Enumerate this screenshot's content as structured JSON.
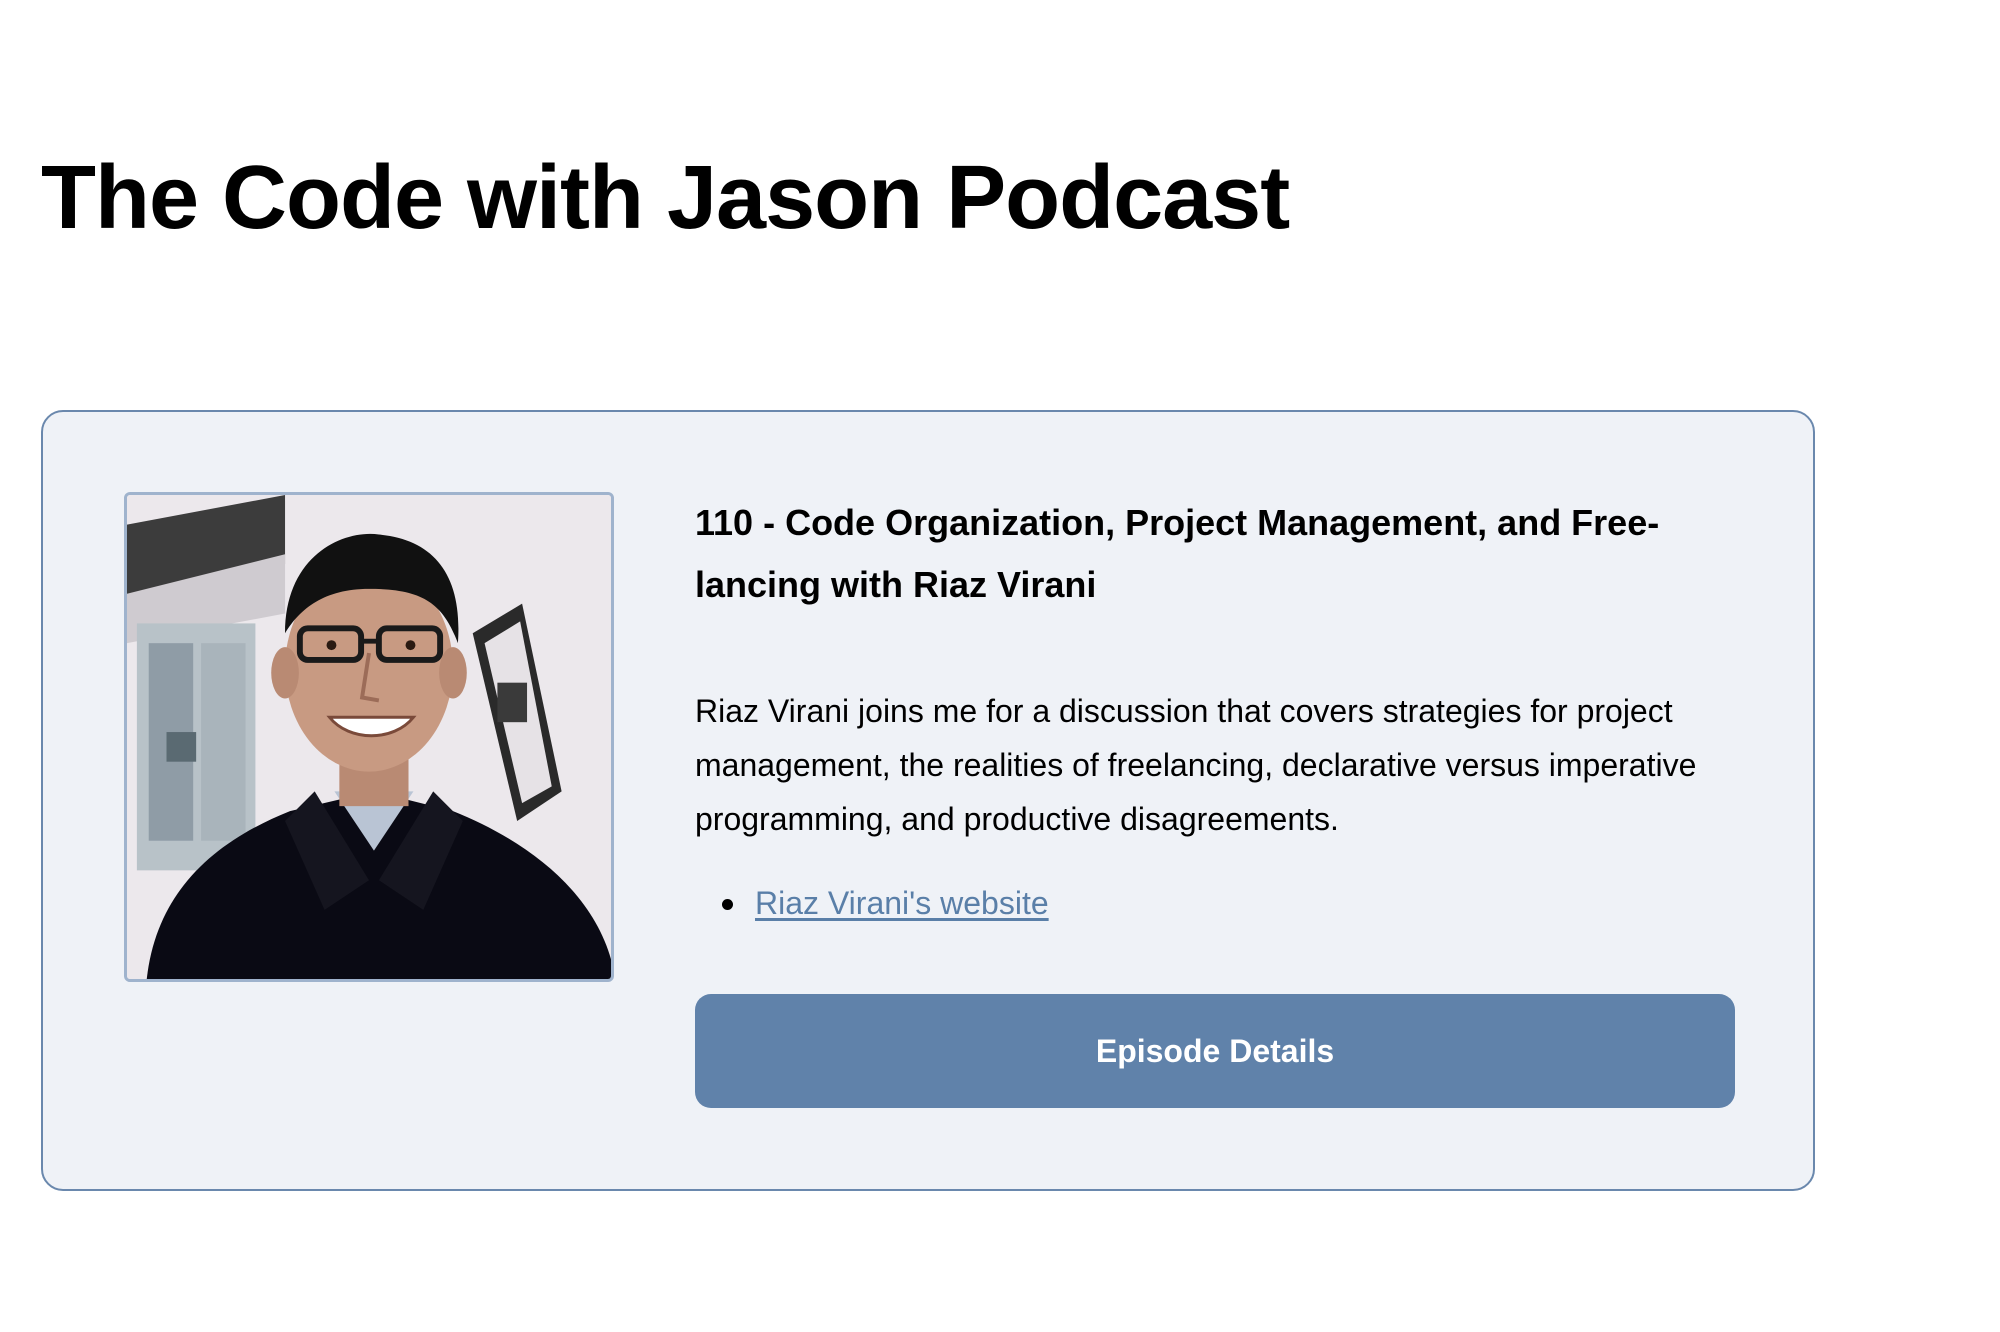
{
  "page": {
    "title": "The Code with Jason Podcast"
  },
  "episode": {
    "title": "110 - Code Organization, Project Management, and Free-lancing with Riaz Virani",
    "description": "Riaz Virani joins me for a discussion that covers strategies for project management, the realities of freelancing, declarative versus imperative programming, and productive disagreements.",
    "links": [
      {
        "label": "Riaz Virani's website"
      }
    ],
    "details_button_label": "Episode Details",
    "photo_alt": "Riaz Virani"
  },
  "colors": {
    "card_background": "#eff2f7",
    "card_border": "#6a88ad",
    "button_background": "#6082aa",
    "link": "#5a7fa8"
  }
}
